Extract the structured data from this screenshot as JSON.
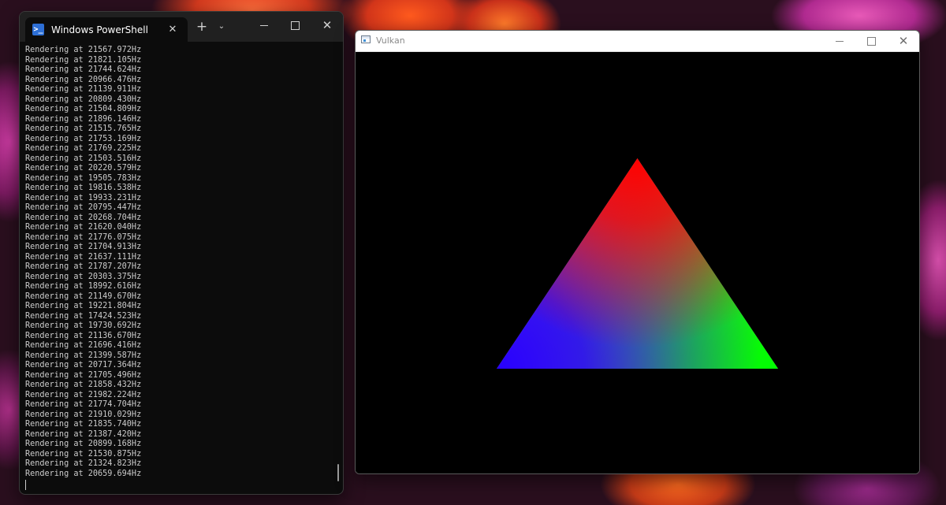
{
  "powershell": {
    "tab_title": "Windows PowerShell",
    "tab_icon_glyph": ">_",
    "newtab_glyph": "+",
    "dropdown_glyph": "⌄",
    "close_glyph": "✕",
    "output_lines": [
      "Rendering at 21567.972Hz",
      "Rendering at 21821.105Hz",
      "Rendering at 21744.624Hz",
      "Rendering at 20966.476Hz",
      "Rendering at 21139.911Hz",
      "Rendering at 20809.430Hz",
      "Rendering at 21504.809Hz",
      "Rendering at 21896.146Hz",
      "Rendering at 21515.765Hz",
      "Rendering at 21753.169Hz",
      "Rendering at 21769.225Hz",
      "Rendering at 21503.516Hz",
      "Rendering at 20220.579Hz",
      "Rendering at 19505.783Hz",
      "Rendering at 19816.538Hz",
      "Rendering at 19933.231Hz",
      "Rendering at 20795.447Hz",
      "Rendering at 20268.704Hz",
      "Rendering at 21620.040Hz",
      "Rendering at 21776.075Hz",
      "Rendering at 21704.913Hz",
      "Rendering at 21637.111Hz",
      "Rendering at 21787.207Hz",
      "Rendering at 20303.375Hz",
      "Rendering at 18992.616Hz",
      "Rendering at 21149.670Hz",
      "Rendering at 19221.804Hz",
      "Rendering at 17424.523Hz",
      "Rendering at 19730.692Hz",
      "Rendering at 21136.670Hz",
      "Rendering at 21696.416Hz",
      "Rendering at 21399.587Hz",
      "Rendering at 20717.364Hz",
      "Rendering at 21705.496Hz",
      "Rendering at 21858.432Hz",
      "Rendering at 21982.224Hz",
      "Rendering at 21774.704Hz",
      "Rendering at 21910.029Hz",
      "Rendering at 21835.740Hz",
      "Rendering at 21387.420Hz",
      "Rendering at 20899.168Hz",
      "Rendering at 21530.875Hz",
      "Rendering at 21324.823Hz",
      "Rendering at 20659.694Hz"
    ]
  },
  "vulkan": {
    "title": "Vulkan",
    "close_glyph": "✕",
    "triangle_colors": {
      "top": "#ff0000",
      "bottom_left": "#2800ff",
      "bottom_right": "#00ff00"
    }
  }
}
